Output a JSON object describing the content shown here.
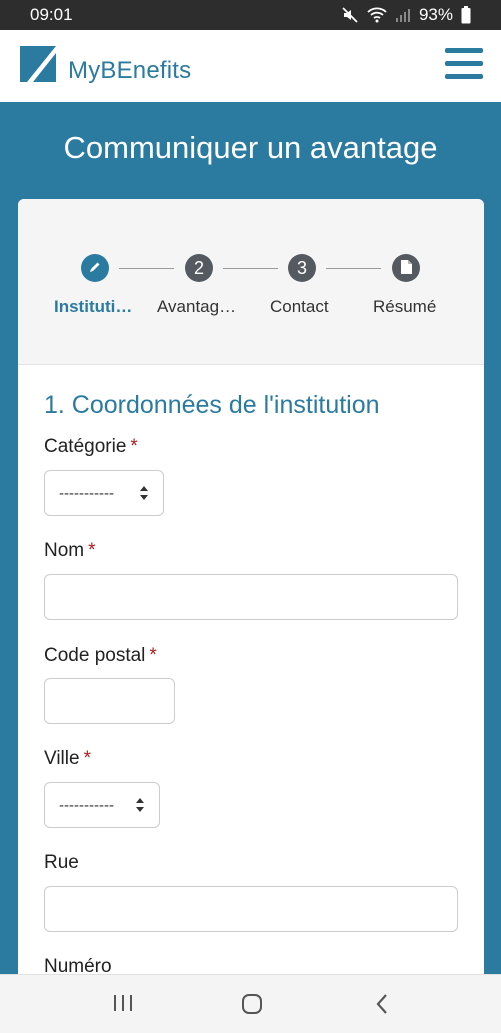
{
  "status": {
    "time": "09:01",
    "battery": "93%"
  },
  "header": {
    "brand": "MyBEnefits"
  },
  "page": {
    "title": "Communiquer un avantage"
  },
  "stepper": {
    "steps": [
      {
        "marker": "",
        "label": "Instituti…",
        "active": true
      },
      {
        "marker": "2",
        "label": "Avantag…",
        "active": false
      },
      {
        "marker": "3",
        "label": "Contact",
        "active": false
      },
      {
        "marker": "",
        "label": "Résumé",
        "active": false
      }
    ]
  },
  "form": {
    "section_title": "1. Coordonnées de l'institution",
    "required_mark": "*",
    "categorie": {
      "label": "Catégorie",
      "value": "-----------"
    },
    "nom": {
      "label": "Nom",
      "value": ""
    },
    "code_postal": {
      "label": "Code postal",
      "value": ""
    },
    "ville": {
      "label": "Ville",
      "value": "-----------"
    },
    "rue": {
      "label": "Rue",
      "value": ""
    },
    "numero": {
      "label": "Numéro"
    }
  },
  "colors": {
    "brand": "#2b7ba1",
    "required": "#b01c1c",
    "step_inactive": "#555a61"
  }
}
